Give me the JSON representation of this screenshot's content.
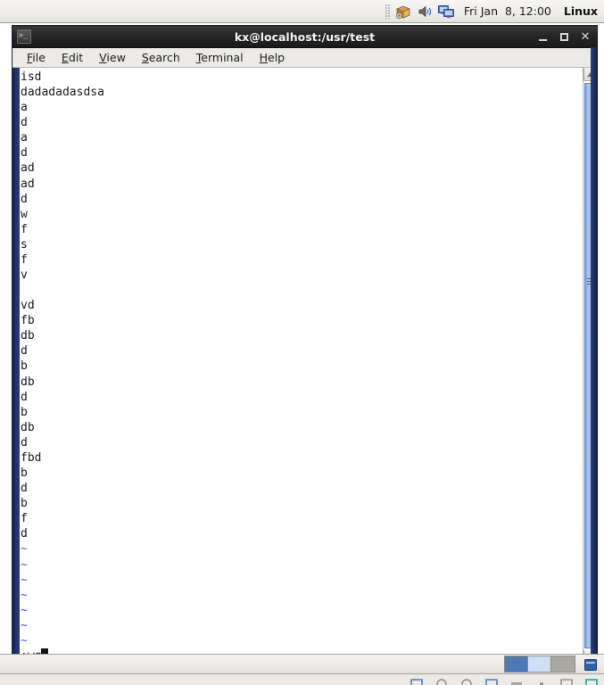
{
  "top_panel": {
    "tray_icons": [
      {
        "name": "package-updates-icon",
        "glyph": "package"
      },
      {
        "name": "volume-icon",
        "glyph": "speaker"
      },
      {
        "name": "network-display-icon",
        "glyph": "monitors"
      }
    ],
    "clock": "Fri Jan  8, 12:00",
    "os_label": "Linux"
  },
  "window": {
    "title": "kx@localhost:/usr/test",
    "icon_name": "terminal-icon",
    "controls": {
      "minimize": "–",
      "maximize": "□",
      "close": "✕"
    },
    "menu": [
      {
        "name": "menu-file",
        "mnemonic": "F",
        "rest": "ile"
      },
      {
        "name": "menu-edit",
        "mnemonic": "E",
        "rest": "dit"
      },
      {
        "name": "menu-view",
        "mnemonic": "V",
        "rest": "iew"
      },
      {
        "name": "menu-search",
        "mnemonic": "S",
        "rest": "earch"
      },
      {
        "name": "menu-terminal",
        "mnemonic": "T",
        "rest": "erminal"
      },
      {
        "name": "menu-help",
        "mnemonic": "H",
        "rest": "elp"
      }
    ]
  },
  "terminal": {
    "lines": [
      "isd",
      "dadadadasdsa",
      "a",
      "d",
      "a",
      "d",
      "ad",
      "ad",
      "d",
      "w",
      "f",
      "s",
      "f",
      "v",
      "",
      "vd",
      "fb",
      "db",
      "d",
      "b",
      "db",
      "d",
      "b",
      "db",
      "d",
      "fbd",
      "b",
      "d",
      "b",
      "f",
      "d"
    ],
    "tilde_count": 7,
    "tilde_char": "~",
    "command_line": ":wq",
    "colors": {
      "background": "#ffffff",
      "foreground": "#1a1a1a",
      "tilde": "#3b5fd6",
      "cursor": "#141414",
      "window_frame": "#22356b",
      "titlebar": "#262626"
    }
  },
  "scrollbar": {
    "name": "terminal-scrollbar",
    "up_arrow": "▲",
    "down_arrow": "▼",
    "thumb_color": "#9cbdea"
  },
  "bottom_panel": {
    "pager_cells": [
      {
        "name": "workspace-1",
        "color": "#4a79b5",
        "active": true
      },
      {
        "name": "workspace-2",
        "color": "#cfe0f6",
        "active": false
      },
      {
        "name": "workspace-3",
        "color": "#a9a7a2",
        "active": false
      }
    ],
    "tray_icon_name": "trash-icon"
  },
  "bottom_strip": {
    "icons": [
      {
        "name": "window-list-icon"
      },
      {
        "name": "disc-icon"
      },
      {
        "name": "disc2-icon"
      },
      {
        "name": "folder-icon"
      },
      {
        "name": "minimize-icon"
      },
      {
        "name": "dot-icon"
      },
      {
        "name": "window-icon"
      },
      {
        "name": "terminal-small-icon"
      }
    ]
  }
}
